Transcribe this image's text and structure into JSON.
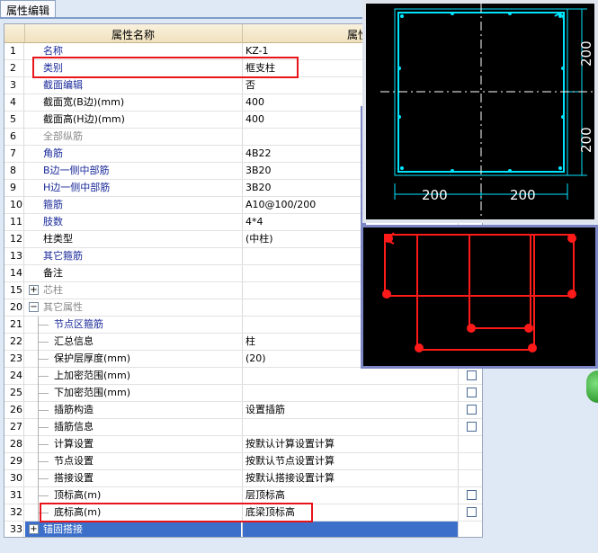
{
  "panel_tab": "属性编辑",
  "header": {
    "name_col": "属性名称",
    "value_col": "属性值"
  },
  "rows": [
    {
      "num": "1",
      "name": "名称",
      "value": "KZ-1",
      "style": "blue"
    },
    {
      "num": "2",
      "name": "类别",
      "value": "框支柱",
      "style": "blue"
    },
    {
      "num": "3",
      "name": "截面编辑",
      "value": "否",
      "style": "blue"
    },
    {
      "num": "4",
      "name": "截面宽(B边)(mm)",
      "value": "400",
      "style": "black"
    },
    {
      "num": "5",
      "name": "截面高(H边)(mm)",
      "value": "400",
      "style": "black"
    },
    {
      "num": "6",
      "name": "全部纵筋",
      "value": "",
      "style": "gray"
    },
    {
      "num": "7",
      "name": "角筋",
      "value": "4B22",
      "style": "blue"
    },
    {
      "num": "8",
      "name": "B边一侧中部筋",
      "value": "3B20",
      "style": "blue"
    },
    {
      "num": "9",
      "name": "H边一侧中部筋",
      "value": "3B20",
      "style": "blue"
    },
    {
      "num": "10",
      "name": "箍筋",
      "value": "A10@100/200",
      "style": "blue"
    },
    {
      "num": "11",
      "name": "肢数",
      "value": "4*4",
      "style": "blue"
    },
    {
      "num": "12",
      "name": "柱类型",
      "value": "(中柱)",
      "style": "black"
    },
    {
      "num": "13",
      "name": "其它箍筋",
      "value": "",
      "style": "blue"
    },
    {
      "num": "14",
      "name": "备注",
      "value": "",
      "style": "black"
    },
    {
      "num": "15",
      "name": "芯柱",
      "value": "",
      "style": "gray",
      "expander": "+"
    },
    {
      "num": "20",
      "name": "其它属性",
      "value": "",
      "style": "gray",
      "expander": "−"
    },
    {
      "num": "21",
      "name": "节点区箍筋",
      "value": "",
      "style": "blue",
      "child": true
    },
    {
      "num": "22",
      "name": "汇总信息",
      "value": "柱",
      "style": "black",
      "child": true
    },
    {
      "num": "23",
      "name": "保护层厚度(mm)",
      "value": "(20)",
      "style": "black",
      "child": true
    },
    {
      "num": "24",
      "name": "上加密范围(mm)",
      "value": "",
      "style": "black",
      "child": true,
      "check": true
    },
    {
      "num": "25",
      "name": "下加密范围(mm)",
      "value": "",
      "style": "black",
      "child": true,
      "check": true
    },
    {
      "num": "26",
      "name": "插筋构造",
      "value": "设置插筋",
      "style": "black",
      "child": true,
      "check": true
    },
    {
      "num": "27",
      "name": "插筋信息",
      "value": "",
      "style": "black",
      "child": true,
      "check": true
    },
    {
      "num": "28",
      "name": "计算设置",
      "value": "按默认计算设置计算",
      "style": "black",
      "child": true
    },
    {
      "num": "29",
      "name": "节点设置",
      "value": "按默认节点设置计算",
      "style": "black",
      "child": true
    },
    {
      "num": "30",
      "name": "搭接设置",
      "value": "按默认搭接设置计算",
      "style": "black",
      "child": true
    },
    {
      "num": "31",
      "name": "顶标高(m)",
      "value": "层顶标高",
      "style": "black",
      "child": true,
      "check": true
    },
    {
      "num": "32",
      "name": "底标高(m)",
      "value": "底梁顶标高",
      "style": "black",
      "child": true,
      "check": true
    },
    {
      "num": "33",
      "name": "锚固搭接",
      "value": "",
      "style": "sel",
      "expander": "+"
    }
  ],
  "section_dims": {
    "top_right_1": "200",
    "top_right_2": "200",
    "bottom_1": "200",
    "bottom_2": "200"
  },
  "colors": {
    "cad_cyan": "#00e5ff",
    "stirrup_red": "#ff1a1a",
    "highlight_red": "#e8141a",
    "selection_blue": "#3b6fc9"
  }
}
